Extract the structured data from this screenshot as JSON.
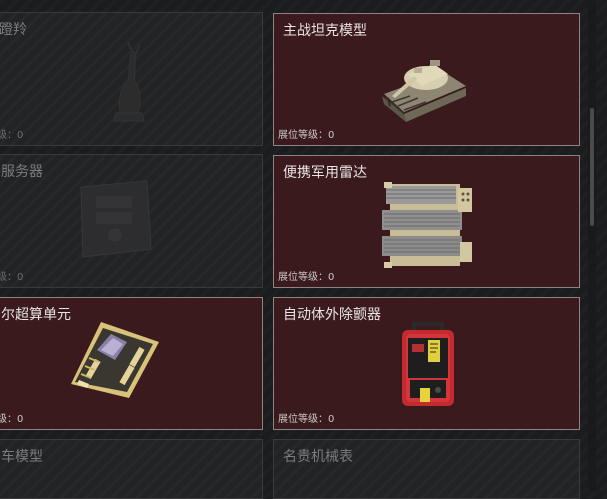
{
  "level_label": "展位等级：0",
  "level_label_clipped": "级：0",
  "cards": [
    {
      "id": "left-row1",
      "title": "蹬羚",
      "state": "locked"
    },
    {
      "id": "right-row1",
      "title": "主战坦克模型",
      "state": "unlocked"
    },
    {
      "id": "left-row2",
      "title": "服务器",
      "state": "locked"
    },
    {
      "id": "right-row2",
      "title": "便携军用雷达",
      "state": "unlocked"
    },
    {
      "id": "left-row3",
      "title": "尔超算单元",
      "state": "unlocked"
    },
    {
      "id": "right-row3",
      "title": "自动体外除颤器",
      "state": "unlocked"
    },
    {
      "id": "left-row4",
      "title": "车模型",
      "state": "locked"
    },
    {
      "id": "right-row4",
      "title": "名贵机械表",
      "state": "locked"
    }
  ],
  "icons": [
    "tank-model-icon",
    "military-radar-icon",
    "supercomputer-unit-icon",
    "aed-defibrillator-icon",
    "gazelle-statue-icon",
    "server-icon"
  ]
}
